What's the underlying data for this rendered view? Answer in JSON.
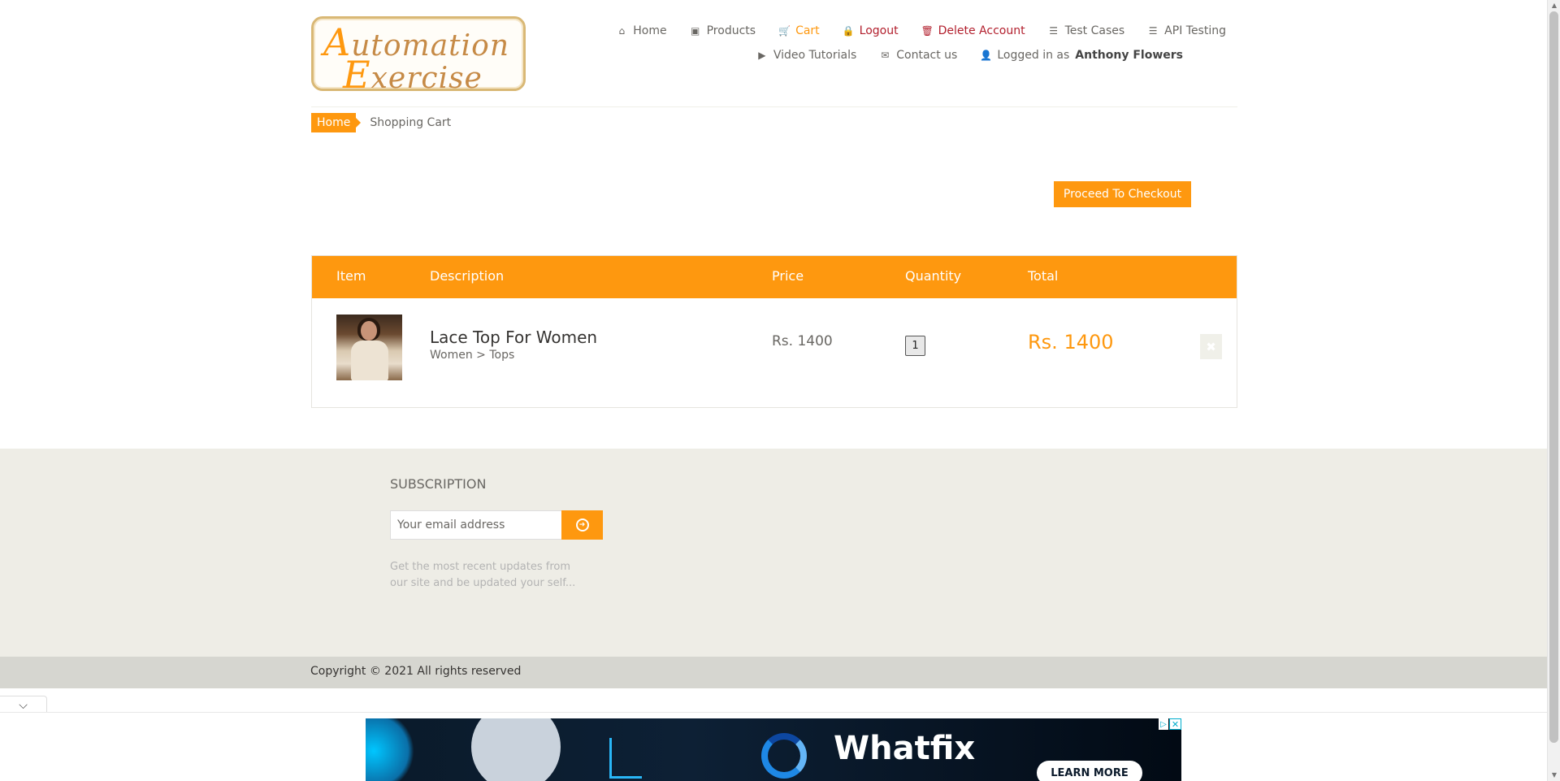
{
  "logo": {
    "line1_initial": "A",
    "line1_rest": "utomation",
    "line2_initial": "E",
    "line2_rest": "xercise"
  },
  "nav": {
    "row1": [
      {
        "label": "Home",
        "icon": "home-icon",
        "glyph": "⌂"
      },
      {
        "label": "Products",
        "icon": "briefcase-icon",
        "glyph": "▣"
      },
      {
        "label": "Cart",
        "icon": "cart-icon",
        "glyph": "🛒"
      },
      {
        "label": "Logout",
        "icon": "lock-icon",
        "glyph": "🔒"
      },
      {
        "label": "Delete Account",
        "icon": "trash-icon",
        "glyph": "🗑"
      },
      {
        "label": "Test Cases",
        "icon": "list-icon",
        "glyph": "☰"
      },
      {
        "label": "API Testing",
        "icon": "list-icon",
        "glyph": "☰"
      }
    ],
    "row2": [
      {
        "label": "Video Tutorials",
        "icon": "youtube-icon",
        "glyph": "▶"
      },
      {
        "label": "Contact us",
        "icon": "envelope-icon",
        "glyph": "✉"
      },
      {
        "label": "Logged in as",
        "icon": "user-icon",
        "glyph": "👤",
        "username": "Anthony Flowers"
      }
    ]
  },
  "breadcrumb": {
    "home": "Home",
    "current": "Shopping Cart"
  },
  "checkout_label": "Proceed To Checkout",
  "cart": {
    "headers": {
      "item": "Item",
      "description": "Description",
      "price": "Price",
      "quantity": "Quantity",
      "total": "Total"
    },
    "rows": [
      {
        "name": "Lace Top For Women",
        "category": "Women > Tops",
        "price": "Rs. 1400",
        "quantity": "1",
        "total": "Rs. 1400",
        "delete_glyph": "✖"
      }
    ]
  },
  "subscription": {
    "title": "SUBSCRIPTION",
    "placeholder": "Your email address",
    "note": "Get the most recent updates from our site and be updated your self..."
  },
  "copyright": "Copyright © 2021 All rights reserved",
  "ad": {
    "brand": "Whatfix",
    "cta": "LEARN MORE",
    "close": "✕",
    "choices": "▷"
  },
  "colors": {
    "accent": "#fe980f",
    "danger": "#b21f2d",
    "footer_bg": "#eeede6"
  }
}
